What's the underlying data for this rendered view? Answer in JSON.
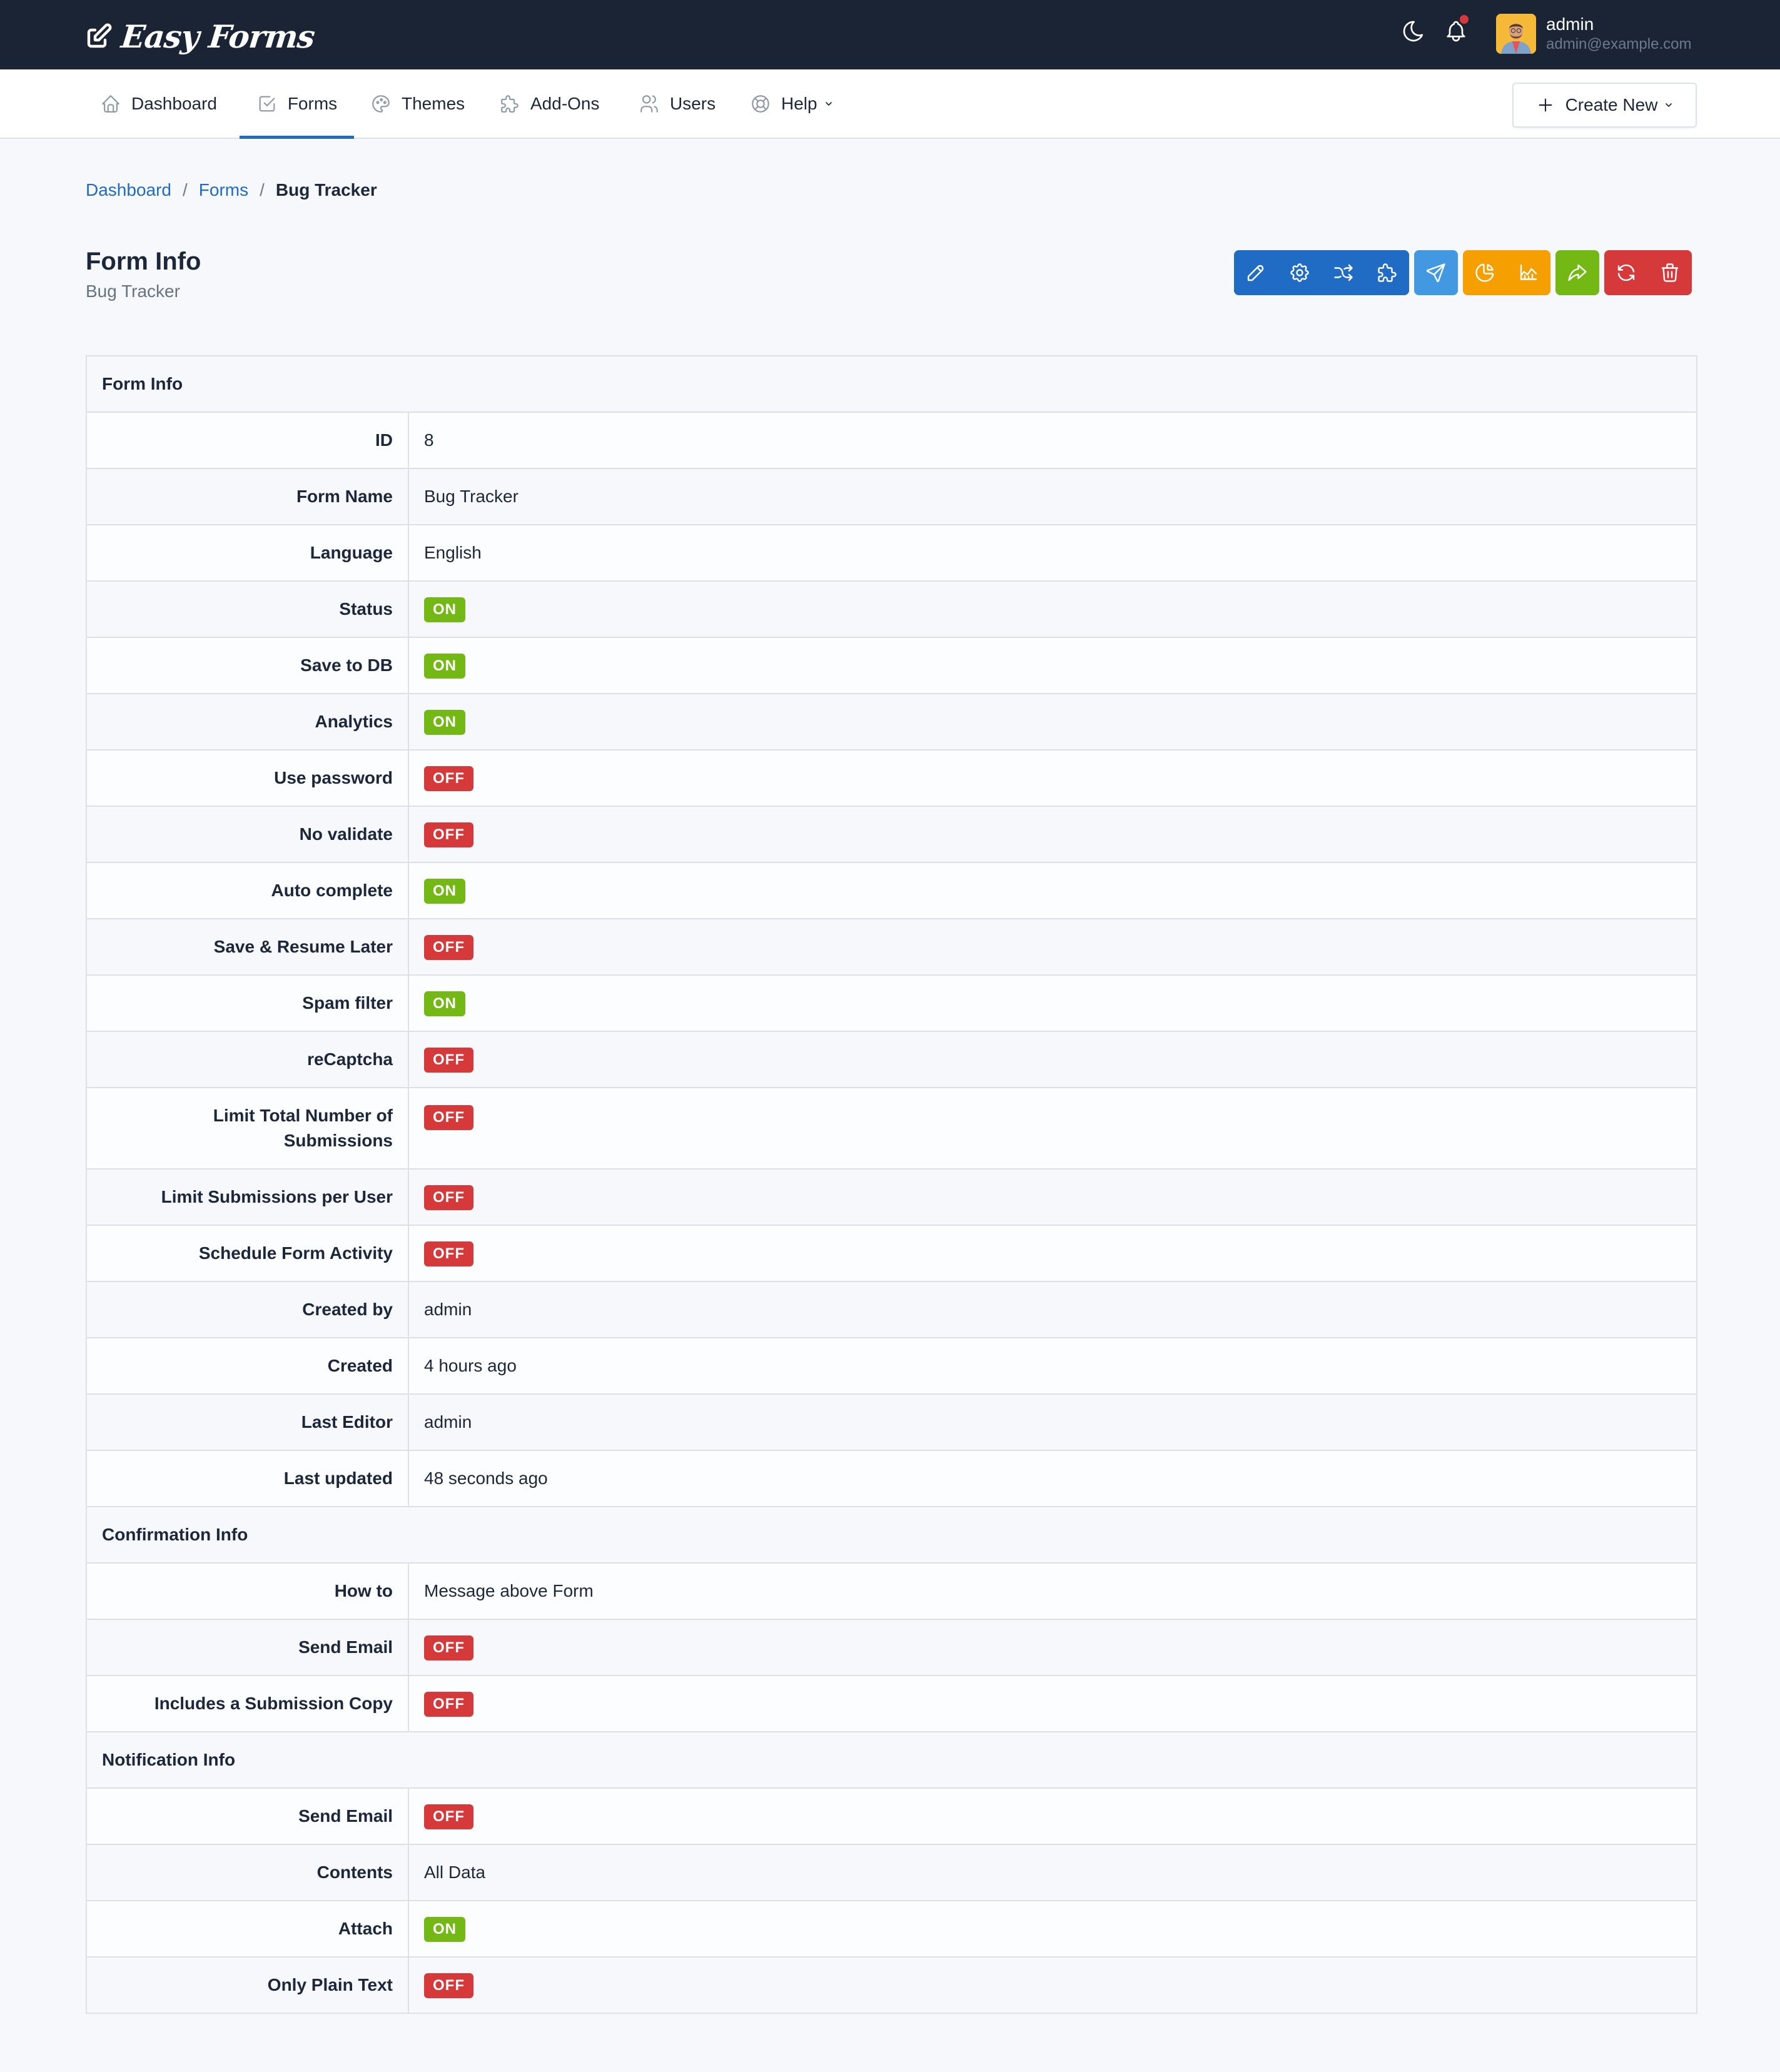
{
  "app": {
    "brand": "Easy Forms",
    "user": {
      "name": "admin",
      "email": "admin@example.com"
    },
    "icons": {
      "theme_toggle": "moon-icon",
      "notifications": "bell-icon",
      "has_unread_notifications": true
    }
  },
  "nav": {
    "items": [
      {
        "label": "Dashboard",
        "icon": "home-icon",
        "active": false
      },
      {
        "label": "Forms",
        "icon": "checkbox-icon",
        "active": true
      },
      {
        "label": "Themes",
        "icon": "palette-icon",
        "active": false
      },
      {
        "label": "Add-Ons",
        "icon": "puzzle-icon",
        "active": false
      },
      {
        "label": "Users",
        "icon": "users-icon",
        "active": false
      },
      {
        "label": "Help",
        "icon": "lifebuoy-icon",
        "active": false,
        "dropdown": true
      }
    ],
    "create_new": "Create New"
  },
  "breadcrumb": [
    {
      "label": "Dashboard",
      "link": true
    },
    {
      "label": "Forms",
      "link": true
    },
    {
      "label": "Bug Tracker",
      "link": false
    }
  ],
  "breadcrumb_separator": "/",
  "page": {
    "title": "Form Info",
    "subtitle": "Bug Tracker"
  },
  "toolbar": {
    "groups": [
      {
        "color": "#206bc4",
        "buttons": [
          "edit",
          "settings",
          "rules",
          "add-ons"
        ]
      },
      {
        "color": "#4299e1",
        "buttons": [
          "share"
        ]
      },
      {
        "color": "#f59f00",
        "buttons": [
          "analytics",
          "stats"
        ]
      },
      {
        "color": "#74b816",
        "buttons": [
          "submissions"
        ]
      },
      {
        "color": "#d63939",
        "buttons": [
          "reset-stats",
          "delete"
        ]
      }
    ]
  },
  "status_labels": {
    "on": "ON",
    "off": "OFF"
  },
  "colors": {
    "on": "#74b816",
    "off": "#d63939",
    "primary": "#206bc4"
  },
  "sections": [
    {
      "title": "Form Info",
      "rows": [
        {
          "label": "ID",
          "value": "8"
        },
        {
          "label": "Form Name",
          "value": "Bug Tracker"
        },
        {
          "label": "Language",
          "value": "English"
        },
        {
          "label": "Status",
          "badge": "ON"
        },
        {
          "label": "Save to DB",
          "badge": "ON"
        },
        {
          "label": "Analytics",
          "badge": "ON"
        },
        {
          "label": "Use password",
          "badge": "OFF"
        },
        {
          "label": "No validate",
          "badge": "OFF"
        },
        {
          "label": "Auto complete",
          "badge": "ON"
        },
        {
          "label": "Save & Resume Later",
          "badge": "OFF"
        },
        {
          "label": "Spam filter",
          "badge": "ON"
        },
        {
          "label": "reCaptcha",
          "badge": "OFF"
        },
        {
          "label": "Limit Total Number of Submissions",
          "badge": "OFF"
        },
        {
          "label": "Limit Submissions per User",
          "badge": "OFF"
        },
        {
          "label": "Schedule Form Activity",
          "badge": "OFF"
        },
        {
          "label": "Created by",
          "value": "admin"
        },
        {
          "label": "Created",
          "value": "4 hours ago"
        },
        {
          "label": "Last Editor",
          "value": "admin"
        },
        {
          "label": "Last updated",
          "value": "48 seconds ago"
        }
      ]
    },
    {
      "title": "Confirmation Info",
      "rows": [
        {
          "label": "How to",
          "value": "Message above Form"
        },
        {
          "label": "Send Email",
          "badge": "OFF"
        },
        {
          "label": "Includes a Submission Copy",
          "badge": "OFF"
        }
      ]
    },
    {
      "title": "Notification Info",
      "rows": [
        {
          "label": "Send Email",
          "badge": "OFF"
        },
        {
          "label": "Contents",
          "value": "All Data"
        },
        {
          "label": "Attach",
          "badge": "ON"
        },
        {
          "label": "Only Plain Text",
          "badge": "OFF"
        }
      ]
    }
  ]
}
